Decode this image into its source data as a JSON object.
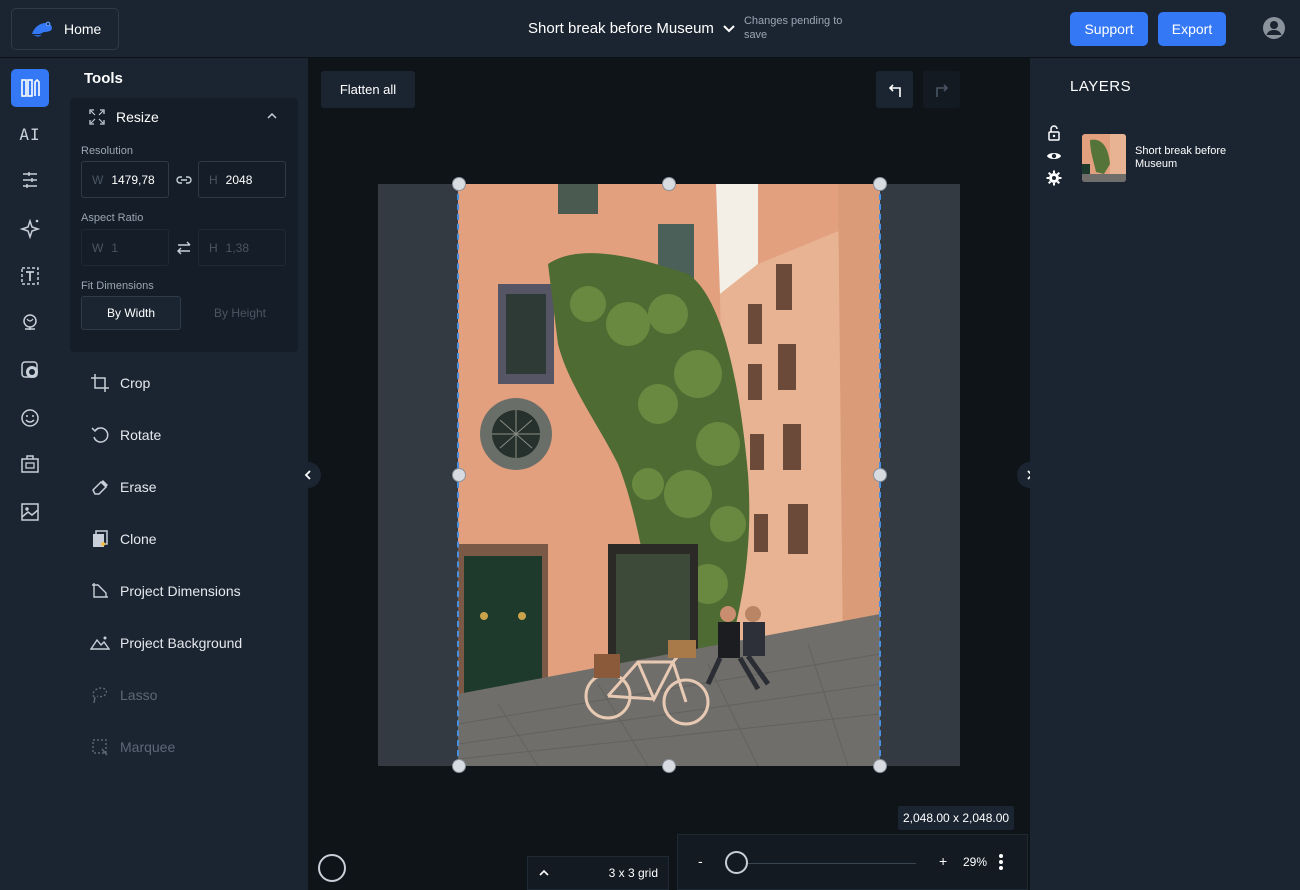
{
  "header": {
    "home_label": "Home",
    "project_title": "Short break before Museum",
    "pending_text": "Changes pending to save",
    "support_label": "Support",
    "export_label": "Export"
  },
  "rail": {
    "items": [
      "tools-icon",
      "ai-text",
      "adjust-icon",
      "effects-icon",
      "text-icon",
      "stickers-icon",
      "overlay-icon",
      "emoji-icon",
      "frames-icon",
      "image-icon"
    ],
    "ai_label": "AI"
  },
  "tools": {
    "title": "Tools",
    "resize": {
      "label": "Resize",
      "resolution_label": "Resolution",
      "width_prefix": "W",
      "width_value": "1479,78",
      "height_prefix": "H",
      "height_value": "2048",
      "aspect_label": "Aspect Ratio",
      "aspect_w_prefix": "W",
      "aspect_w_value": "1",
      "aspect_h_prefix": "H",
      "aspect_h_value": "1,38",
      "fit_label": "Fit Dimensions",
      "by_width": "By Width",
      "by_height": "By Height"
    },
    "items": [
      {
        "label": "Crop",
        "enabled": true
      },
      {
        "label": "Rotate",
        "enabled": true
      },
      {
        "label": "Erase",
        "enabled": true
      },
      {
        "label": "Clone",
        "enabled": true
      },
      {
        "label": "Project Dimensions",
        "enabled": true
      },
      {
        "label": "Project Background",
        "enabled": true
      },
      {
        "label": "Lasso",
        "enabled": false
      },
      {
        "label": "Marquee",
        "enabled": false
      }
    ]
  },
  "canvas": {
    "flatten_label": "Flatten all",
    "dims_tooltip": "2,048.00 x 2,048.00",
    "grid_label": "3 x 3 grid",
    "zoom_minus": "-",
    "zoom_plus": "+",
    "zoom_percent": "29%",
    "zoom_level": 0.29
  },
  "layers": {
    "title": "LAYERS",
    "layer_name": "Short break before Museum"
  },
  "colors": {
    "accent": "#3478f6",
    "panel": "#1b2531",
    "background": "#0f1419",
    "selection": "#4a90e2"
  }
}
